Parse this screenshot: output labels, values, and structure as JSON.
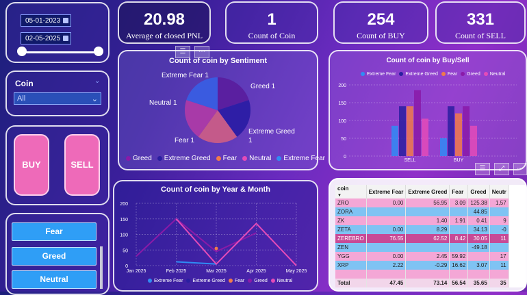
{
  "filters": {
    "date_start": "05-01-2023",
    "date_end": "02-05-2025",
    "coin_label": "Coin",
    "coin_value": "All"
  },
  "kpis": [
    {
      "value": "20.98",
      "label": "Average of closed PNL"
    },
    {
      "value": "1",
      "label": "Count of Coin"
    },
    {
      "value": "254",
      "label": "Count of BUY"
    },
    {
      "value": "331",
      "label": "Count of SELL"
    }
  ],
  "buttons": {
    "buy": "BUY",
    "sell": "SELL"
  },
  "sentiment_buttons": [
    "Fear",
    "Greed",
    "Neutral"
  ],
  "colors": {
    "greed": "#8a1aa8",
    "extreme_greed": "#2a1fa0",
    "fear": "#f07a4a",
    "neutral": "#e44bb8",
    "extreme_fear": "#2f8cf4",
    "button_pink": "#ee6ab9",
    "button_blue": "#2f9ef6"
  },
  "pie_chart": {
    "title": "Count of coin by Sentiment",
    "labels": {
      "greed": "Greed 1",
      "extreme_greed_a": "Extreme Greed",
      "extreme_greed_b": "1",
      "fear": "Fear 1",
      "neutral": "Neutral 1",
      "extreme_fear": "Extreme Fear 1"
    },
    "legend": [
      "Greed",
      "Extreme Greed",
      "Fear",
      "Neutral",
      "Extreme Fear"
    ]
  },
  "bar_chart": {
    "title": "Count of coin by Buy/Sell",
    "legend": [
      "Extreme Fear",
      "Extreme Greed",
      "Fear",
      "Greed",
      "Neutral"
    ],
    "y_ticks": [
      "200",
      "150",
      "100",
      "50",
      "0"
    ],
    "categories": [
      "SELL",
      "BUY"
    ]
  },
  "line_chart": {
    "title": "Count of coin by Year & Month",
    "y_ticks": [
      "200",
      "150",
      "100",
      "50",
      "0"
    ],
    "x_ticks": [
      "Jan 2025",
      "Feb 2025",
      "Mar 2025",
      "Apr 2025",
      "May 2025"
    ],
    "legend": [
      "Extreme Fear",
      "Extreme Greed",
      "Fear",
      "Greed",
      "Neutral"
    ]
  },
  "chart_data": [
    {
      "type": "pie",
      "title": "Count of coin by Sentiment",
      "categories": [
        "Greed",
        "Extreme Greed",
        "Fear",
        "Neutral",
        "Extreme Fear"
      ],
      "values": [
        1,
        1,
        1,
        1,
        1
      ],
      "legend_position": "bottom"
    },
    {
      "type": "bar",
      "title": "Count of coin by Buy/Sell",
      "categories": [
        "SELL",
        "BUY"
      ],
      "series": [
        {
          "name": "Extreme Fear",
          "values": [
            85,
            50
          ]
        },
        {
          "name": "Extreme Greed",
          "values": [
            140,
            140
          ]
        },
        {
          "name": "Fear",
          "values": [
            140,
            120
          ]
        },
        {
          "name": "Greed",
          "values": [
            185,
            140
          ]
        },
        {
          "name": "Neutral",
          "values": [
            105,
            85
          ]
        }
      ],
      "ylim": [
        0,
        200
      ],
      "legend_position": "top"
    },
    {
      "type": "line",
      "title": "Count of coin by Year & Month",
      "x": [
        "Jan 2025",
        "Feb 2025",
        "Mar 2025",
        "Apr 2025",
        "May 2025"
      ],
      "series": [
        {
          "name": "Extreme Fear",
          "values": [
            null,
            12,
            5,
            null,
            null
          ]
        },
        {
          "name": "Extreme Greed",
          "values": [
            null,
            null,
            null,
            null,
            null
          ]
        },
        {
          "name": "Fear",
          "values": [
            null,
            null,
            55,
            null,
            null
          ]
        },
        {
          "name": "Greed",
          "values": [
            30,
            150,
            45,
            105,
            null
          ]
        },
        {
          "name": "Neutral",
          "values": [
            null,
            150,
            5,
            135,
            0
          ]
        }
      ],
      "ylim": [
        0,
        200
      ],
      "legend_position": "bottom"
    }
  ],
  "table": {
    "headers": [
      "coin",
      "Extreme Fear",
      "Extreme Greed",
      "Fear",
      "Greed",
      "Neutr"
    ],
    "rows": [
      {
        "style": "pink",
        "cells": [
          "ZRO",
          "0.00",
          "56.95",
          "3.09",
          "125.38",
          "1,57"
        ]
      },
      {
        "style": "blue",
        "cells": [
          "ZORA",
          "",
          "",
          "",
          "44.85",
          ""
        ]
      },
      {
        "style": "pink",
        "cells": [
          "ZK",
          "",
          "1.40",
          "1.91",
          "0.41",
          "9"
        ]
      },
      {
        "style": "blue",
        "cells": [
          "ZETA",
          "0.00",
          "8.29",
          "",
          "34.13",
          "-0"
        ]
      },
      {
        "style": "dark",
        "cells": [
          "ZEREBRO",
          "76.55",
          "62.52",
          "8.42",
          "30.05",
          "11"
        ]
      },
      {
        "style": "blue",
        "cells": [
          "ZEN",
          "",
          "",
          "",
          "-49.18",
          ""
        ]
      },
      {
        "style": "pink",
        "cells": [
          "YGG",
          "0.00",
          "2.45",
          "59.92",
          "",
          "17"
        ]
      },
      {
        "style": "blue",
        "cells": [
          "XRP",
          "2.22",
          "-0.29",
          "16.62",
          "3.07",
          "11"
        ]
      },
      {
        "style": "pink",
        "cells": [
          "",
          "",
          "",
          "",
          "",
          ""
        ]
      }
    ],
    "total": [
      "Total",
      "47.45",
      "73.14",
      "56.54",
      "35.65",
      "35"
    ]
  }
}
